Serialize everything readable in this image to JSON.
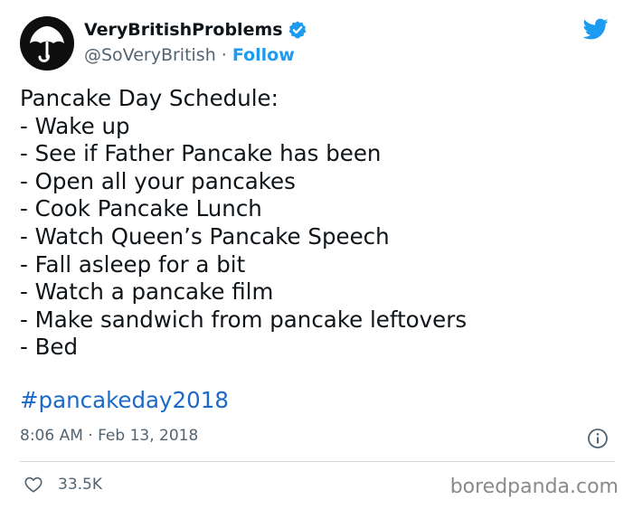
{
  "author": {
    "display_name": "VeryBritishProblems",
    "handle": "@SoVeryBritish",
    "separator": "·",
    "follow_label": "Follow",
    "avatar_icon": "umbrella-icon",
    "verified_icon": "verified-badge-icon"
  },
  "tweet": {
    "lines": [
      "Pancake Day Schedule:",
      "- Wake up",
      "- See if Father Pancake has been",
      "- Open all your pancakes",
      "- Cook Pancake Lunch",
      "- Watch Queen’s Pancake Speech",
      "- Fall asleep for a bit",
      "- Watch a pancake film",
      "- Make sandwich from pancake leftovers",
      "- Bed"
    ],
    "hashtag": "#pancakeday2018",
    "timestamp": "8:06 AM · Feb 13, 2018"
  },
  "engagement": {
    "likes": "33.5K",
    "like_icon": "heart-icon",
    "info_icon": "info-icon"
  },
  "watermark": "boredpanda.com",
  "colors": {
    "link": "#1d9bf0",
    "hashtag": "#1b6ac9",
    "secondary_text": "#536471",
    "twitter_blue": "#1d9bf0"
  }
}
